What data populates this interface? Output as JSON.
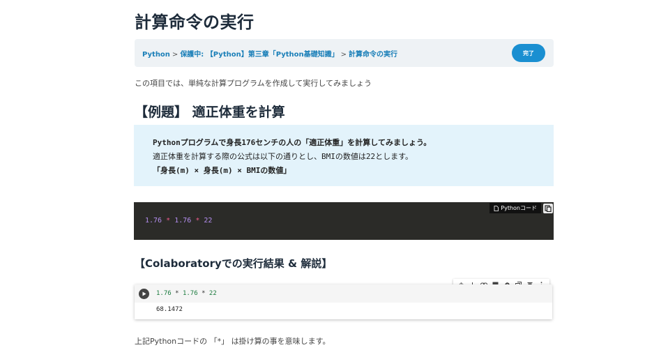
{
  "page": {
    "title": "計算命令の実行"
  },
  "breadcrumb": {
    "items": [
      "Python",
      "保護中: 【Python】第三章「Python基礎知識」",
      "計算命令の実行"
    ],
    "separator": ">"
  },
  "complete_button": {
    "label": "完了"
  },
  "intro": {
    "text": "この項目では、単純な計算プログラムを作成して実行してみましょう"
  },
  "example": {
    "heading": "【例題】 適正体重を計算",
    "lines": [
      "Pythonプログラムで身長176センチの人の「適正体重」を計算してみましょう。",
      "適正体重を計算する際の公式は以下の通りとし、BMIの数値は22とします。",
      "「身長(m) × 身長(m) × BMIの数値」"
    ]
  },
  "code_block": {
    "label": "Pythonコード",
    "tokens": {
      "n1": "1.76",
      "op1": "*",
      "n2": "1.76",
      "op2": "*",
      "n3": "22"
    }
  },
  "result": {
    "heading": "【Colaboratoryでの実行結果 & 解説】",
    "cell_code": {
      "n1": "1.76",
      "op1": "*",
      "n2": "1.76",
      "op2": "*",
      "n3": "22"
    },
    "output": "68.1472"
  },
  "cell_toolbar": {
    "icons": [
      "arrow-up-icon",
      "arrow-down-icon",
      "link-icon",
      "comment-icon",
      "settings-icon",
      "mirror-cell-icon",
      "delete-icon",
      "more-icon"
    ]
  },
  "footer": {
    "text": "上記Pythonコードの 「*」 は掛け算の事を意味します。"
  },
  "colors": {
    "accent": "#1a8fd1",
    "breadcrumb_link": "#1a7fb8",
    "example_bg": "#e3f3fb",
    "code_bg": "#2b2b28",
    "code_number": "#b48ef0",
    "code_operator": "#f05a8a",
    "colab_number": "#1b7a3e"
  }
}
